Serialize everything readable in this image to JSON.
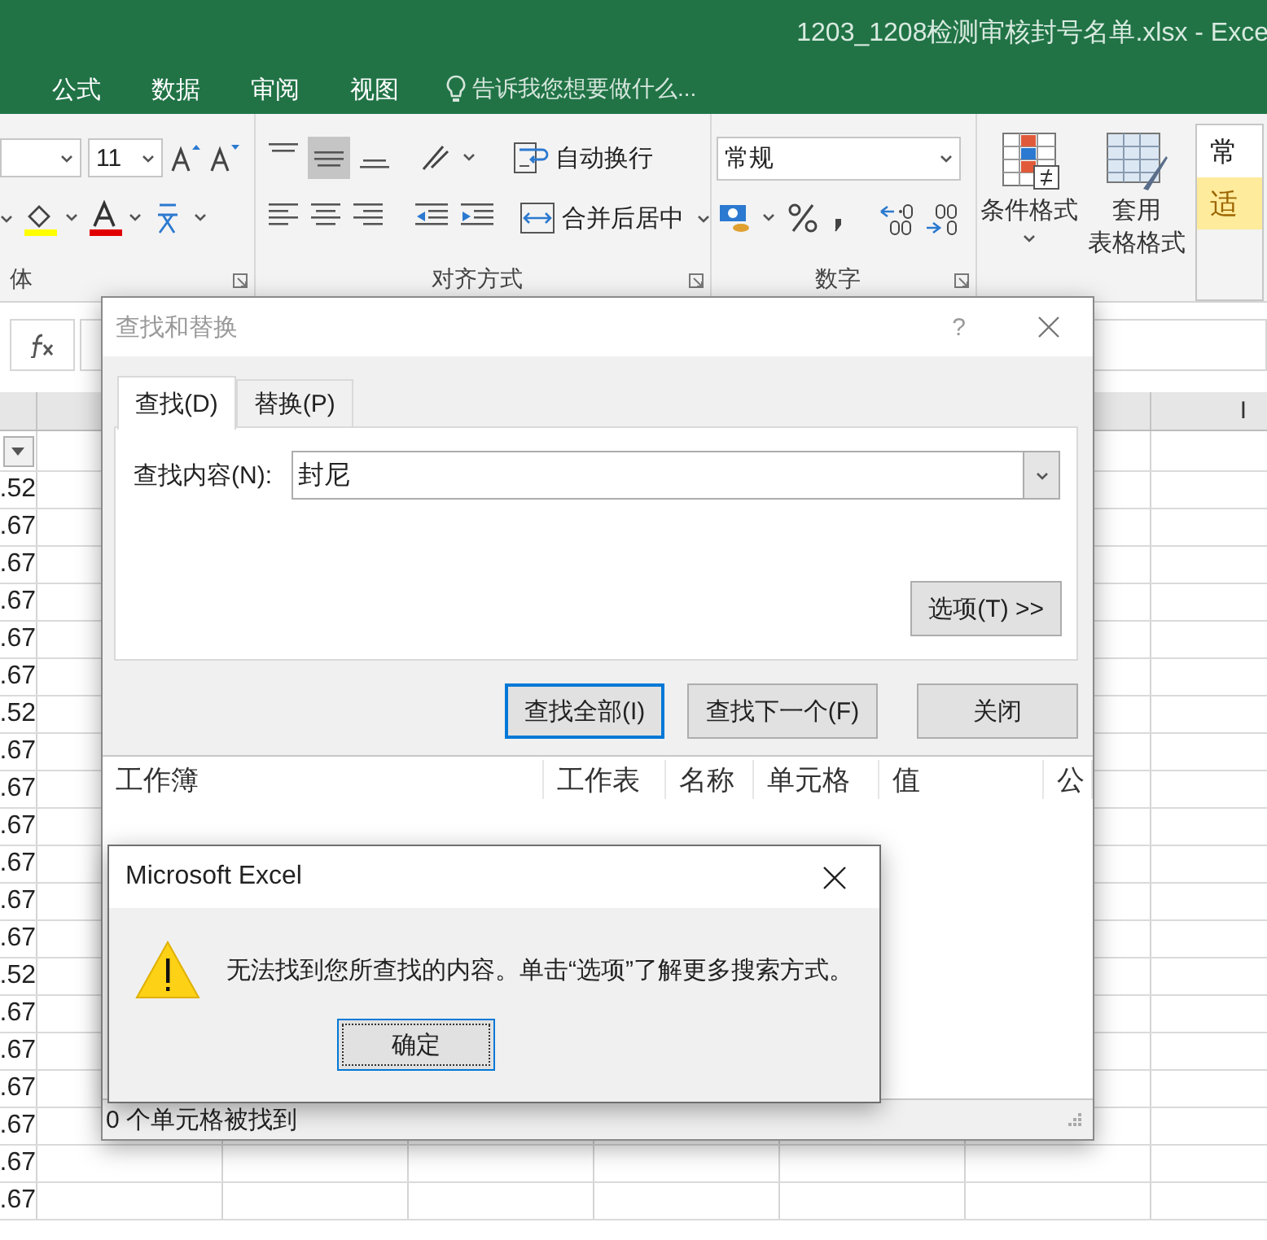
{
  "window": {
    "title": "1203_1208检测审核封号名单.xlsx - Exce"
  },
  "ribbon_tabs": [
    {
      "label": "公式"
    },
    {
      "label": "数据"
    },
    {
      "label": "审阅"
    },
    {
      "label": "视图"
    }
  ],
  "tell_me": {
    "placeholder": "告诉我您想要做什么..."
  },
  "ribbon": {
    "font_size": "11",
    "font_group_label": "体",
    "wrap_text": "自动换行",
    "merge_center": "合并后居中",
    "alignment_label": "对齐方式",
    "number_format": "常规",
    "number_label": "数字",
    "conditional_formatting": "条件格式",
    "format_as_table": [
      "套用",
      "表格格式"
    ],
    "style_gallery": [
      {
        "label": "常",
        "kind": "normal"
      },
      {
        "label": "适",
        "kind": "neutral"
      }
    ]
  },
  "sheet": {
    "column_header": "I",
    "rows": [
      ".52",
      ".67",
      ".67",
      ".67",
      ".67",
      ".67",
      ".52",
      ".67",
      ".67",
      ".67",
      ".67",
      ".67",
      ".67",
      ".52",
      ".67",
      ".67",
      ".67",
      ".67",
      ".67",
      ".67"
    ]
  },
  "find_dialog": {
    "title": "查找和替换",
    "help": "?",
    "tabs": [
      {
        "label": "查找(D)",
        "selected": true
      },
      {
        "label": "替换(P)",
        "selected": false
      }
    ],
    "find_label": "查找内容(N):",
    "find_value": "封尼",
    "options_button": "选项(T) >>",
    "buttons": [
      {
        "label": "查找全部(I)",
        "default": true
      },
      {
        "label": "查找下一个(F)",
        "default": false
      },
      {
        "label": "关闭",
        "default": false
      }
    ],
    "result_columns": [
      "工作簿",
      "工作表",
      "名称",
      "单元格",
      "值",
      "公"
    ],
    "status": "0 个单元格被找到"
  },
  "alert": {
    "title": "Microsoft Excel",
    "message": "无法找到您所查找的内容。单击“选项”了解更多搜索方式。",
    "button": {
      "label": "确定",
      "focused": true
    }
  }
}
